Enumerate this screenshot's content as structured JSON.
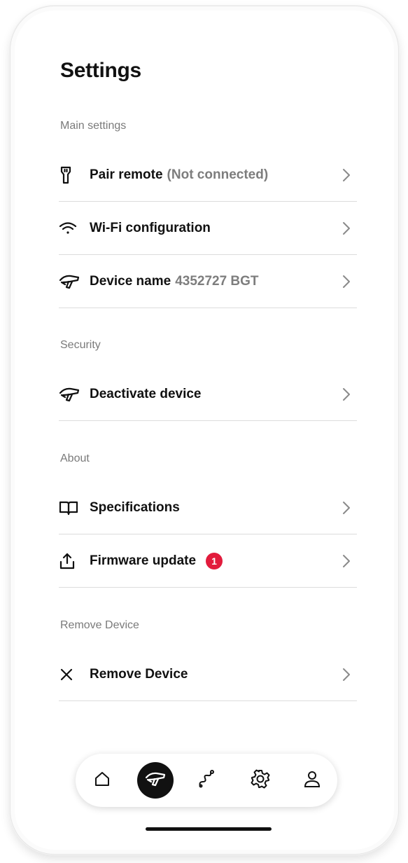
{
  "page": {
    "title": "Settings"
  },
  "sections": {
    "main": {
      "label": "Main settings",
      "items": [
        {
          "label": "Pair remote",
          "sub": "(Not connected)",
          "icon": "remote-icon"
        },
        {
          "label": "Wi-Fi configuration",
          "icon": "wifi-icon"
        },
        {
          "label": "Device name",
          "sub": "4352727 BGT",
          "icon": "hair-dryer-icon"
        }
      ]
    },
    "security": {
      "label": "Security",
      "items": [
        {
          "label": "Deactivate device",
          "icon": "hair-dryer-icon"
        }
      ]
    },
    "about": {
      "label": "About",
      "items": [
        {
          "label": "Specifications",
          "icon": "book-icon"
        },
        {
          "label": "Firmware update",
          "badge": "1",
          "icon": "upload-icon"
        }
      ]
    },
    "remove": {
      "label": "Remove Device",
      "items": [
        {
          "label": "Remove Device",
          "icon": "close-icon"
        }
      ]
    }
  },
  "nav": {
    "items": [
      {
        "icon": "home-icon",
        "active": false
      },
      {
        "icon": "hair-dryer-icon",
        "active": true
      },
      {
        "icon": "styling-path-icon",
        "active": false
      },
      {
        "icon": "gear-icon",
        "active": false
      },
      {
        "icon": "user-icon",
        "active": false
      }
    ]
  },
  "colors": {
    "badge": "#e21b3c",
    "secondary_text": "#7d7d7d",
    "section_label": "#7a7a7a",
    "divider": "#dcdcdc",
    "active_nav": "#111111"
  }
}
